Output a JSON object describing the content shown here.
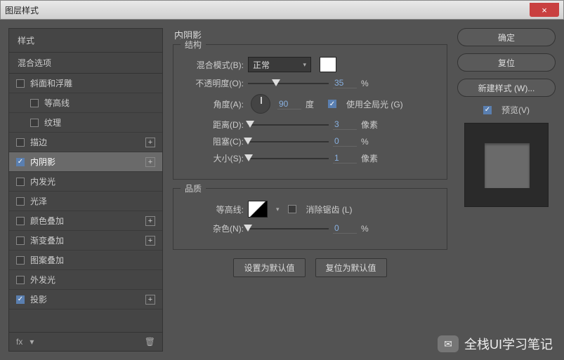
{
  "window": {
    "title": "图层样式",
    "close": "×"
  },
  "sidebar": {
    "header": "样式",
    "sub": "混合选项",
    "items": [
      {
        "label": "斜面和浮雕",
        "checked": false,
        "plus": false,
        "indent": false
      },
      {
        "label": "等高线",
        "checked": false,
        "plus": false,
        "indent": true
      },
      {
        "label": "纹理",
        "checked": false,
        "plus": false,
        "indent": true
      },
      {
        "label": "描边",
        "checked": false,
        "plus": true,
        "indent": false
      },
      {
        "label": "内阴影",
        "checked": true,
        "plus": true,
        "indent": false,
        "selected": true
      },
      {
        "label": "内发光",
        "checked": false,
        "plus": false,
        "indent": false
      },
      {
        "label": "光泽",
        "checked": false,
        "plus": false,
        "indent": false
      },
      {
        "label": "颜色叠加",
        "checked": false,
        "plus": true,
        "indent": false
      },
      {
        "label": "渐变叠加",
        "checked": false,
        "plus": true,
        "indent": false
      },
      {
        "label": "图案叠加",
        "checked": false,
        "plus": false,
        "indent": false
      },
      {
        "label": "外发光",
        "checked": false,
        "plus": false,
        "indent": false
      },
      {
        "label": "投影",
        "checked": true,
        "plus": true,
        "indent": false
      }
    ],
    "footer_fx": "fx"
  },
  "main": {
    "title": "内阴影",
    "structure": {
      "legend": "结构",
      "blend_label": "混合模式(B):",
      "blend_value": "正常",
      "color": "#ffffff",
      "opacity_label": "不透明度(O):",
      "opacity_value": "35",
      "opacity_unit": "%",
      "angle_label": "角度(A):",
      "angle_value": "90",
      "angle_unit": "度",
      "global_light": "使用全局光 (G)",
      "global_checked": true,
      "distance_label": "距离(D):",
      "distance_value": "3",
      "distance_unit": "像素",
      "choke_label": "阻塞(C):",
      "choke_value": "0",
      "choke_unit": "%",
      "size_label": "大小(S):",
      "size_value": "1",
      "size_unit": "像素"
    },
    "quality": {
      "legend": "品质",
      "contour_label": "等高线:",
      "aa_label": "消除锯齿 (L)",
      "aa_checked": false,
      "noise_label": "杂色(N):",
      "noise_value": "0",
      "noise_unit": "%"
    },
    "buttons": {
      "default": "设置为默认值",
      "reset": "复位为默认值"
    }
  },
  "right": {
    "ok": "确定",
    "cancel": "复位",
    "new_style": "新建样式 (W)...",
    "preview_label": "预览(V)",
    "preview_checked": true
  },
  "watermark": "全栈UI学习笔记"
}
